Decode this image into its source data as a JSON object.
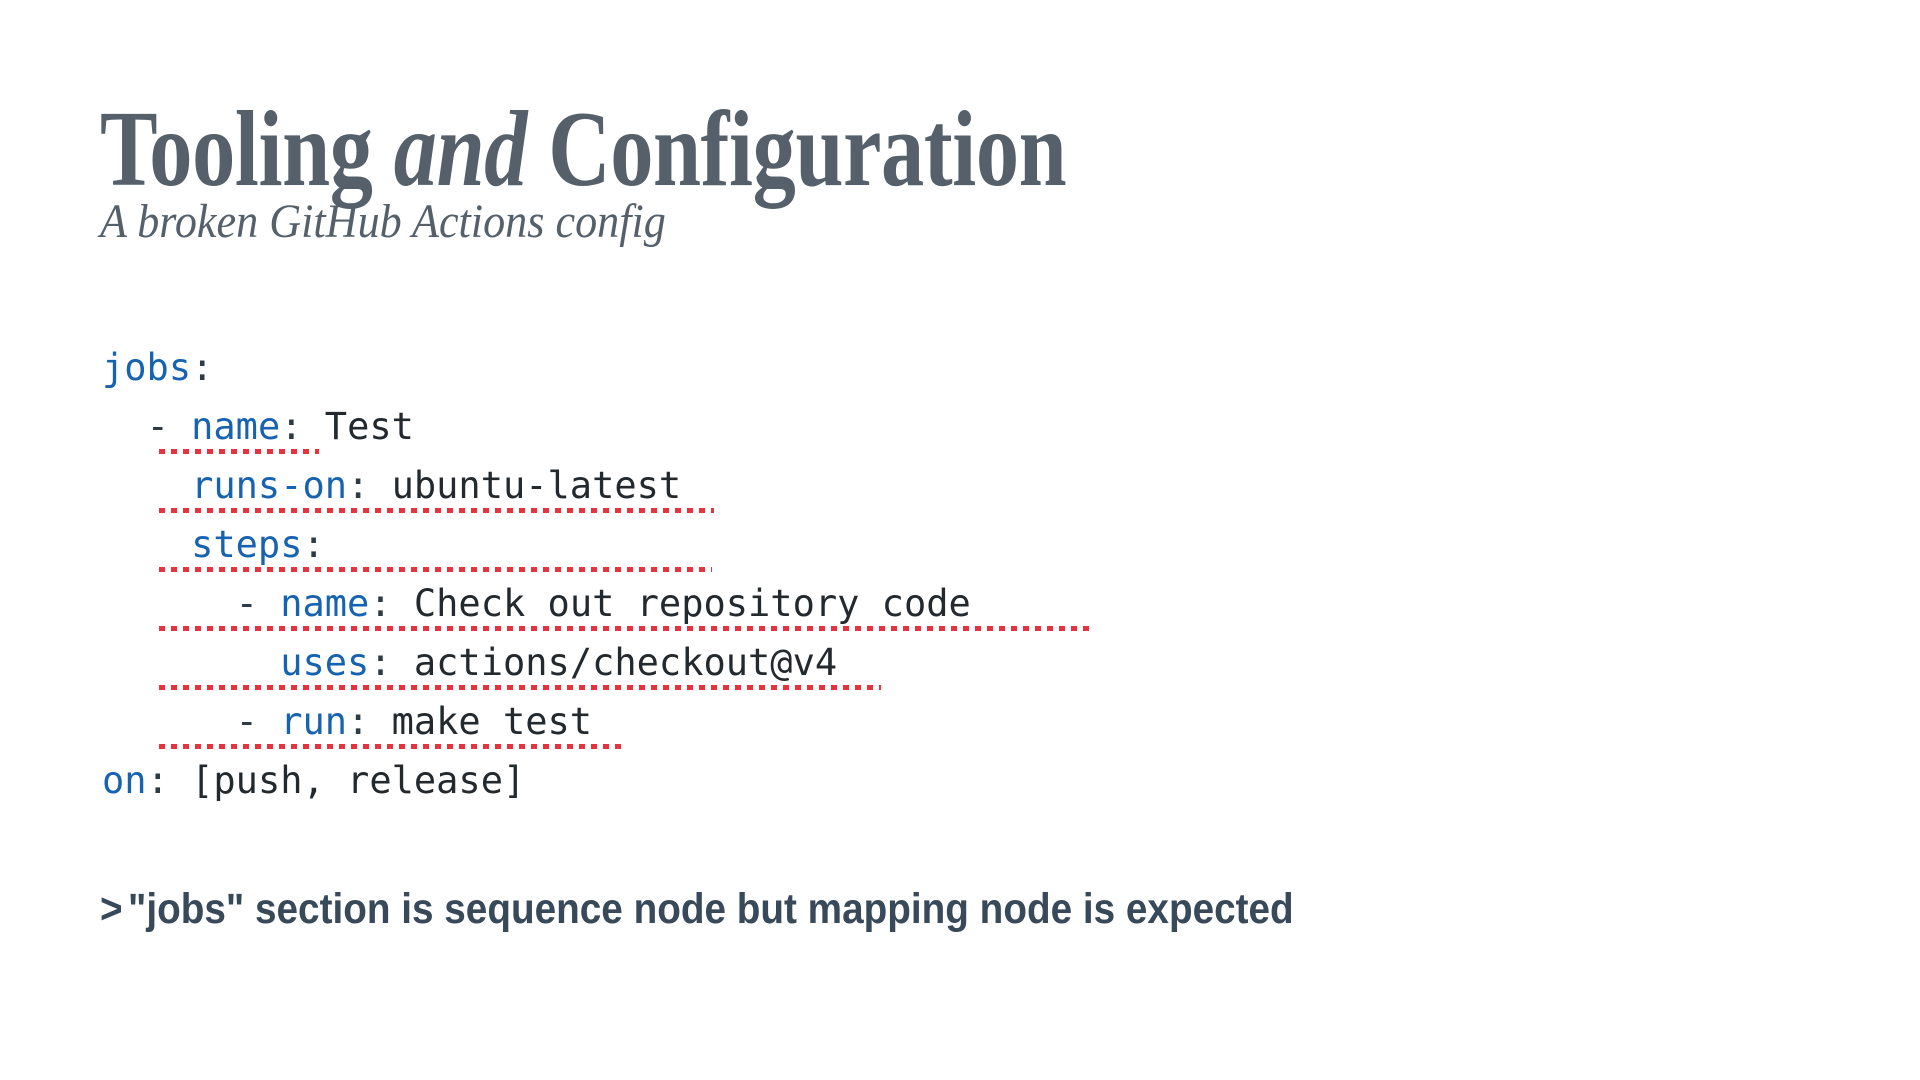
{
  "slide": {
    "title": {
      "part1": "Tooling ",
      "emphasis": "and",
      "part2": " Configuration"
    },
    "subtitle": "A broken GitHub Actions config",
    "code": {
      "language": "yaml",
      "lines": [
        {
          "indent": 0,
          "dash": "",
          "key": "jobs",
          "colon": ":",
          "value": "",
          "error": false,
          "underline_width": 0
        },
        {
          "indent": 2,
          "dash": "- ",
          "key": "name",
          "colon": ":",
          "value": " Test",
          "error": true,
          "underline_width": 160
        },
        {
          "indent": 4,
          "dash": "",
          "key": "runs-on",
          "colon": ":",
          "value": " ubuntu-latest",
          "error": true,
          "underline_width": 555
        },
        {
          "indent": 4,
          "dash": "",
          "key": "steps",
          "colon": ":",
          "value": "",
          "error": true,
          "underline_width": 553
        },
        {
          "indent": 6,
          "dash": "- ",
          "key": "name",
          "colon": ":",
          "value": " Check out repository code",
          "error": true,
          "underline_width": 934
        },
        {
          "indent": 8,
          "dash": "",
          "key": "uses",
          "colon": ":",
          "value": " actions/checkout@v4",
          "error": true,
          "underline_width": 722
        },
        {
          "indent": 6,
          "dash": "- ",
          "key": "run",
          "colon": ":",
          "value": " make test",
          "error": true,
          "underline_width": 464
        },
        {
          "indent": 0,
          "dash": "",
          "key": "on",
          "colon": ":",
          "value": " [push, release]",
          "error": false,
          "underline_width": 0
        }
      ]
    },
    "error_message": {
      "caret": ">",
      "text": "\"jobs\" section is sequence node but mapping node is expected"
    },
    "colors": {
      "title": "#55606b",
      "subtitle": "#55606b",
      "code_key": "#1763b0",
      "code_value": "#24292e",
      "error_underline": "#e8323c",
      "error_message": "#38495a",
      "background": "#ffffff"
    }
  }
}
